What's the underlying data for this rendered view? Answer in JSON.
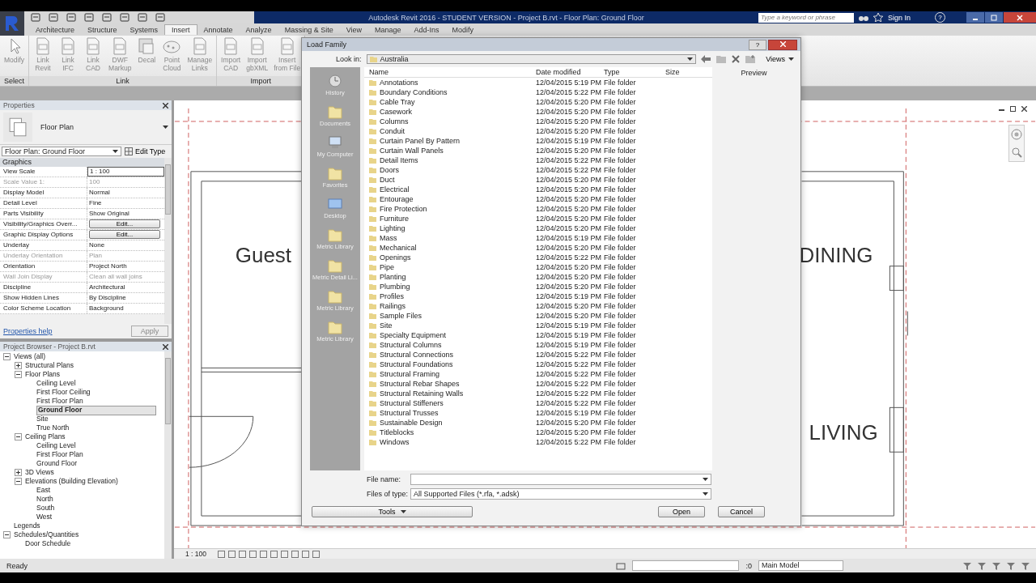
{
  "title_bar": {
    "title": "Autodesk Revit 2016 - STUDENT VERSION -   Project B.rvt - Floor Plan: Ground Floor",
    "search_placeholder": "Type a keyword or phrase",
    "sign_in": "Sign In",
    "help": "?"
  },
  "tabs": [
    {
      "label": "Architecture",
      "selected": false
    },
    {
      "label": "Structure",
      "selected": false
    },
    {
      "label": "Systems",
      "selected": false
    },
    {
      "label": "Insert",
      "selected": true
    },
    {
      "label": "Annotate",
      "selected": false
    },
    {
      "label": "Analyze",
      "selected": false
    },
    {
      "label": "Massing & Site",
      "selected": false
    },
    {
      "label": "View",
      "selected": false
    },
    {
      "label": "Manage",
      "selected": false
    },
    {
      "label": "Add-Ins",
      "selected": false
    },
    {
      "label": "Modify",
      "selected": false
    }
  ],
  "ribbon": [
    {
      "label": "Select",
      "tools": [
        {
          "label": "Modify",
          "kind": "cursor"
        }
      ]
    },
    {
      "label": "Link",
      "tools": [
        {
          "label": "Link\nRevit",
          "kind": "doc"
        },
        {
          "label": "Link\nIFC",
          "kind": "doc"
        },
        {
          "label": "Link\nCAD",
          "kind": "doc"
        },
        {
          "label": "DWF\nMarkup",
          "kind": "doc"
        },
        {
          "label": "Decal",
          "kind": "image"
        },
        {
          "label": "Point\nCloud",
          "kind": "cloud"
        },
        {
          "label": "Manage\nLinks",
          "kind": "doc"
        }
      ]
    },
    {
      "label": "Import",
      "tools": [
        {
          "label": "Import\nCAD",
          "kind": "doc"
        },
        {
          "label": "Import\ngbXML",
          "kind": "doc"
        },
        {
          "label": "Insert\nfrom File",
          "kind": "doc"
        }
      ]
    }
  ],
  "properties": {
    "title": "Properties",
    "type": "Floor Plan",
    "selector": "Floor Plan: Ground Floor",
    "edit_type": "Edit Type",
    "section": "Graphics",
    "rows": [
      {
        "label": "View Scale",
        "value": "1 : 100",
        "kind": "field",
        "disabled": false
      },
      {
        "label": "Scale Value    1:",
        "value": "100",
        "kind": "text",
        "disabled": true
      },
      {
        "label": "Display Model",
        "value": "Normal",
        "kind": "text",
        "disabled": false
      },
      {
        "label": "Detail Level",
        "value": "Fine",
        "kind": "text",
        "disabled": false
      },
      {
        "label": "Parts Visibility",
        "value": "Show Original",
        "kind": "text",
        "disabled": false
      },
      {
        "label": "Visibility/Graphics Overr...",
        "value": "Edit...",
        "kind": "button",
        "disabled": false
      },
      {
        "label": "Graphic Display Options",
        "value": "Edit...",
        "kind": "button",
        "disabled": false
      },
      {
        "label": "Underlay",
        "value": "None",
        "kind": "text",
        "disabled": false
      },
      {
        "label": "Underlay Orientation",
        "value": "Plan",
        "kind": "text",
        "disabled": true
      },
      {
        "label": "Orientation",
        "value": "Project North",
        "kind": "text",
        "disabled": false
      },
      {
        "label": "Wall Join Display",
        "value": "Clean all wall joins",
        "kind": "text",
        "disabled": true
      },
      {
        "label": "Discipline",
        "value": "Architectural",
        "kind": "text",
        "disabled": false
      },
      {
        "label": "Show Hidden Lines",
        "value": "By Discipline",
        "kind": "text",
        "disabled": false
      },
      {
        "label": "Color Scheme Location",
        "value": "Background",
        "kind": "text",
        "disabled": false
      }
    ],
    "help": "Properties help",
    "apply": "Apply"
  },
  "browser": {
    "title": "Project Browser - Project B.rvt",
    "tree": [
      {
        "label": "Views (all)",
        "expanded": true,
        "selected": false,
        "children": [
          {
            "label": "Structural Plans",
            "expanded": false,
            "selected": false
          },
          {
            "label": "Floor Plans",
            "expanded": true,
            "selected": false,
            "children": [
              {
                "label": "Ceiling Level",
                "selected": false
              },
              {
                "label": "First Floor Ceiling",
                "selected": false
              },
              {
                "label": "First Floor Plan",
                "selected": false
              },
              {
                "label": "Ground Floor",
                "selected": true
              },
              {
                "label": "Site",
                "selected": false
              },
              {
                "label": "True North",
                "selected": false
              }
            ]
          },
          {
            "label": "Ceiling Plans",
            "expanded": true,
            "selected": false,
            "children": [
              {
                "label": "Ceiling Level",
                "selected": false
              },
              {
                "label": "First Floor Plan",
                "selected": false
              },
              {
                "label": "Ground Floor",
                "selected": false
              }
            ]
          },
          {
            "label": "3D Views",
            "expanded": false,
            "selected": false
          },
          {
            "label": "Elevations (Building Elevation)",
            "expanded": true,
            "selected": false,
            "children": [
              {
                "label": "East",
                "selected": false
              },
              {
                "label": "North",
                "selected": false
              },
              {
                "label": "South",
                "selected": false
              },
              {
                "label": "West",
                "selected": false
              }
            ]
          }
        ]
      },
      {
        "label": "Legends",
        "selected": false
      },
      {
        "label": "Schedules/Quantities",
        "expanded": true,
        "selected": false,
        "children": [
          {
            "label": "Door Schedule",
            "selected": false
          }
        ]
      }
    ]
  },
  "canvas": {
    "rooms": [
      "Guest",
      "DINING",
      "LIVING"
    ],
    "scale": "1 : 100"
  },
  "dialog": {
    "title": "Load Family",
    "help": "?",
    "look_in_label": "Look in:",
    "look_in": "Australia",
    "views": "Views",
    "preview": "Preview",
    "places": [
      {
        "label": "History",
        "kind": "history"
      },
      {
        "label": "Documents",
        "kind": "folder"
      },
      {
        "label": "My Computer",
        "kind": "computer"
      },
      {
        "label": "Favorites",
        "kind": "folder"
      },
      {
        "label": "Desktop",
        "kind": "desktop"
      },
      {
        "label": "Metric Library",
        "kind": "folder"
      },
      {
        "label": "Metric Detail Li...",
        "kind": "folder"
      },
      {
        "label": "Metric Library",
        "kind": "folder"
      },
      {
        "label": "Metric Library",
        "kind": "folder"
      }
    ],
    "columns": [
      "Name",
      "Date modified",
      "Type",
      "Size"
    ],
    "files": [
      {
        "name": "Annotations",
        "date": "12/04/2015 5:19 PM",
        "type": "File folder"
      },
      {
        "name": "Boundary Conditions",
        "date": "12/04/2015 5:22 PM",
        "type": "File folder"
      },
      {
        "name": "Cable Tray",
        "date": "12/04/2015 5:20 PM",
        "type": "File folder"
      },
      {
        "name": "Casework",
        "date": "12/04/2015 5:20 PM",
        "type": "File folder"
      },
      {
        "name": "Columns",
        "date": "12/04/2015 5:20 PM",
        "type": "File folder"
      },
      {
        "name": "Conduit",
        "date": "12/04/2015 5:20 PM",
        "type": "File folder"
      },
      {
        "name": "Curtain Panel By Pattern",
        "date": "12/04/2015 5:19 PM",
        "type": "File folder"
      },
      {
        "name": "Curtain Wall Panels",
        "date": "12/04/2015 5:20 PM",
        "type": "File folder"
      },
      {
        "name": "Detail Items",
        "date": "12/04/2015 5:22 PM",
        "type": "File folder"
      },
      {
        "name": "Doors",
        "date": "12/04/2015 5:22 PM",
        "type": "File folder"
      },
      {
        "name": "Duct",
        "date": "12/04/2015 5:20 PM",
        "type": "File folder"
      },
      {
        "name": "Electrical",
        "date": "12/04/2015 5:20 PM",
        "type": "File folder"
      },
      {
        "name": "Entourage",
        "date": "12/04/2015 5:20 PM",
        "type": "File folder"
      },
      {
        "name": "Fire Protection",
        "date": "12/04/2015 5:20 PM",
        "type": "File folder"
      },
      {
        "name": "Furniture",
        "date": "12/04/2015 5:20 PM",
        "type": "File folder"
      },
      {
        "name": "Lighting",
        "date": "12/04/2015 5:20 PM",
        "type": "File folder"
      },
      {
        "name": "Mass",
        "date": "12/04/2015 5:19 PM",
        "type": "File folder"
      },
      {
        "name": "Mechanical",
        "date": "12/04/2015 5:20 PM",
        "type": "File folder"
      },
      {
        "name": "Openings",
        "date": "12/04/2015 5:22 PM",
        "type": "File folder"
      },
      {
        "name": "Pipe",
        "date": "12/04/2015 5:20 PM",
        "type": "File folder"
      },
      {
        "name": "Planting",
        "date": "12/04/2015 5:20 PM",
        "type": "File folder"
      },
      {
        "name": "Plumbing",
        "date": "12/04/2015 5:20 PM",
        "type": "File folder"
      },
      {
        "name": "Profiles",
        "date": "12/04/2015 5:19 PM",
        "type": "File folder"
      },
      {
        "name": "Railings",
        "date": "12/04/2015 5:20 PM",
        "type": "File folder"
      },
      {
        "name": "Sample Files",
        "date": "12/04/2015 5:20 PM",
        "type": "File folder"
      },
      {
        "name": "Site",
        "date": "12/04/2015 5:19 PM",
        "type": "File folder"
      },
      {
        "name": "Specialty Equipment",
        "date": "12/04/2015 5:19 PM",
        "type": "File folder"
      },
      {
        "name": "Structural Columns",
        "date": "12/04/2015 5:19 PM",
        "type": "File folder"
      },
      {
        "name": "Structural Connections",
        "date": "12/04/2015 5:22 PM",
        "type": "File folder"
      },
      {
        "name": "Structural Foundations",
        "date": "12/04/2015 5:22 PM",
        "type": "File folder"
      },
      {
        "name": "Structural Framing",
        "date": "12/04/2015 5:22 PM",
        "type": "File folder"
      },
      {
        "name": "Structural Rebar Shapes",
        "date": "12/04/2015 5:22 PM",
        "type": "File folder"
      },
      {
        "name": "Structural Retaining Walls",
        "date": "12/04/2015 5:22 PM",
        "type": "File folder"
      },
      {
        "name": "Structural Stiffeners",
        "date": "12/04/2015 5:22 PM",
        "type": "File folder"
      },
      {
        "name": "Structural Trusses",
        "date": "12/04/2015 5:19 PM",
        "type": "File folder"
      },
      {
        "name": "Sustainable Design",
        "date": "12/04/2015 5:20 PM",
        "type": "File folder"
      },
      {
        "name": "Titleblocks",
        "date": "12/04/2015 5:20 PM",
        "type": "File folder"
      },
      {
        "name": "Windows",
        "date": "12/04/2015 5:22 PM",
        "type": "File folder"
      }
    ],
    "file_name_label": "File name:",
    "file_type_label": "Files of type:",
    "file_type": "All Supported Files  (*.rfa, *.adsk)",
    "tools": "Tools",
    "open": "Open",
    "cancel": "Cancel"
  },
  "status_bar": {
    "text": "Ready",
    "count": ":0",
    "model": "Main Model"
  }
}
